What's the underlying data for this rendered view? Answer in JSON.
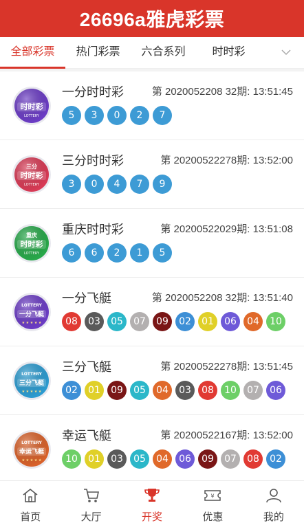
{
  "header": {
    "title": "26696a雅虎彩票"
  },
  "tabs": [
    {
      "label": "全部彩票",
      "active": true
    },
    {
      "label": "热门彩票",
      "active": false
    },
    {
      "label": "六合系列",
      "active": false
    },
    {
      "label": "时时彩",
      "active": false
    }
  ],
  "ball_colors": {
    "blue": "#3d9bd5",
    "01": "#e0d028",
    "02": "#3d8fd6",
    "03": "#5a5a5a",
    "04": "#e0692a",
    "05": "#2bb7c9",
    "06": "#6e5ad8",
    "07": "#b3b0b0",
    "08": "#e13a33",
    "09": "#7a1616",
    "10": "#6dcf67"
  },
  "lotteries": [
    {
      "name": "一分时时彩",
      "issue": "第 2020052208 32期: 13:51:45",
      "logo": "一分时时彩-logo",
      "logo_color": "#6b3cc4",
      "logo_text": "时时彩",
      "logo_top": "",
      "style": "blue",
      "numbers": [
        "5",
        "3",
        "0",
        "2",
        "7"
      ]
    },
    {
      "name": "三分时时彩",
      "issue": "第 20200522278期: 13:52:00",
      "logo": "三分时时彩-logo",
      "logo_color": "#d83a55",
      "logo_text": "时时彩",
      "logo_top": "三分",
      "style": "blue",
      "numbers": [
        "3",
        "0",
        "4",
        "7",
        "9"
      ]
    },
    {
      "name": "重庆时时彩",
      "issue": "第 20200522029期: 13:51:08",
      "logo": "重庆时时彩-logo",
      "logo_color": "#28a84a",
      "logo_text": "时时彩",
      "logo_top": "重庆",
      "style": "blue",
      "numbers": [
        "6",
        "6",
        "2",
        "1",
        "5"
      ]
    },
    {
      "name": "一分飞艇",
      "issue": "第 2020052208 32期: 13:51:40",
      "logo": "一分飞艇-logo",
      "logo_color": "#6b3cc4",
      "logo_text": "一分飞艇",
      "logo_top": "LOTTERY",
      "style": "color",
      "numbers": [
        "08",
        "03",
        "05",
        "07",
        "09",
        "02",
        "01",
        "06",
        "04",
        "10"
      ]
    },
    {
      "name": "三分飞艇",
      "issue": "第 20200522278期: 13:51:45",
      "logo": "三分飞艇-logo",
      "logo_color": "#2c9bd0",
      "logo_text": "三分飞艇",
      "logo_top": "LOTTERY",
      "style": "color",
      "numbers": [
        "02",
        "01",
        "09",
        "05",
        "04",
        "03",
        "08",
        "10",
        "07",
        "06"
      ]
    },
    {
      "name": "幸运飞艇",
      "issue": "第 20200522167期: 13:52:00",
      "logo": "幸运飞艇-logo",
      "logo_color": "#d8612a",
      "logo_text": "幸运飞艇",
      "logo_top": "LOTTERY",
      "style": "color",
      "numbers": [
        "10",
        "01",
        "03",
        "05",
        "04",
        "06",
        "09",
        "07",
        "08",
        "02"
      ]
    }
  ],
  "bottom_nav": [
    {
      "label": "首页",
      "icon": "home-icon",
      "active": false
    },
    {
      "label": "大厅",
      "icon": "cart-icon",
      "active": false
    },
    {
      "label": "开奖",
      "icon": "trophy-icon",
      "active": true
    },
    {
      "label": "优惠",
      "icon": "ticket-icon",
      "active": false
    },
    {
      "label": "我的",
      "icon": "user-icon",
      "active": false
    }
  ]
}
